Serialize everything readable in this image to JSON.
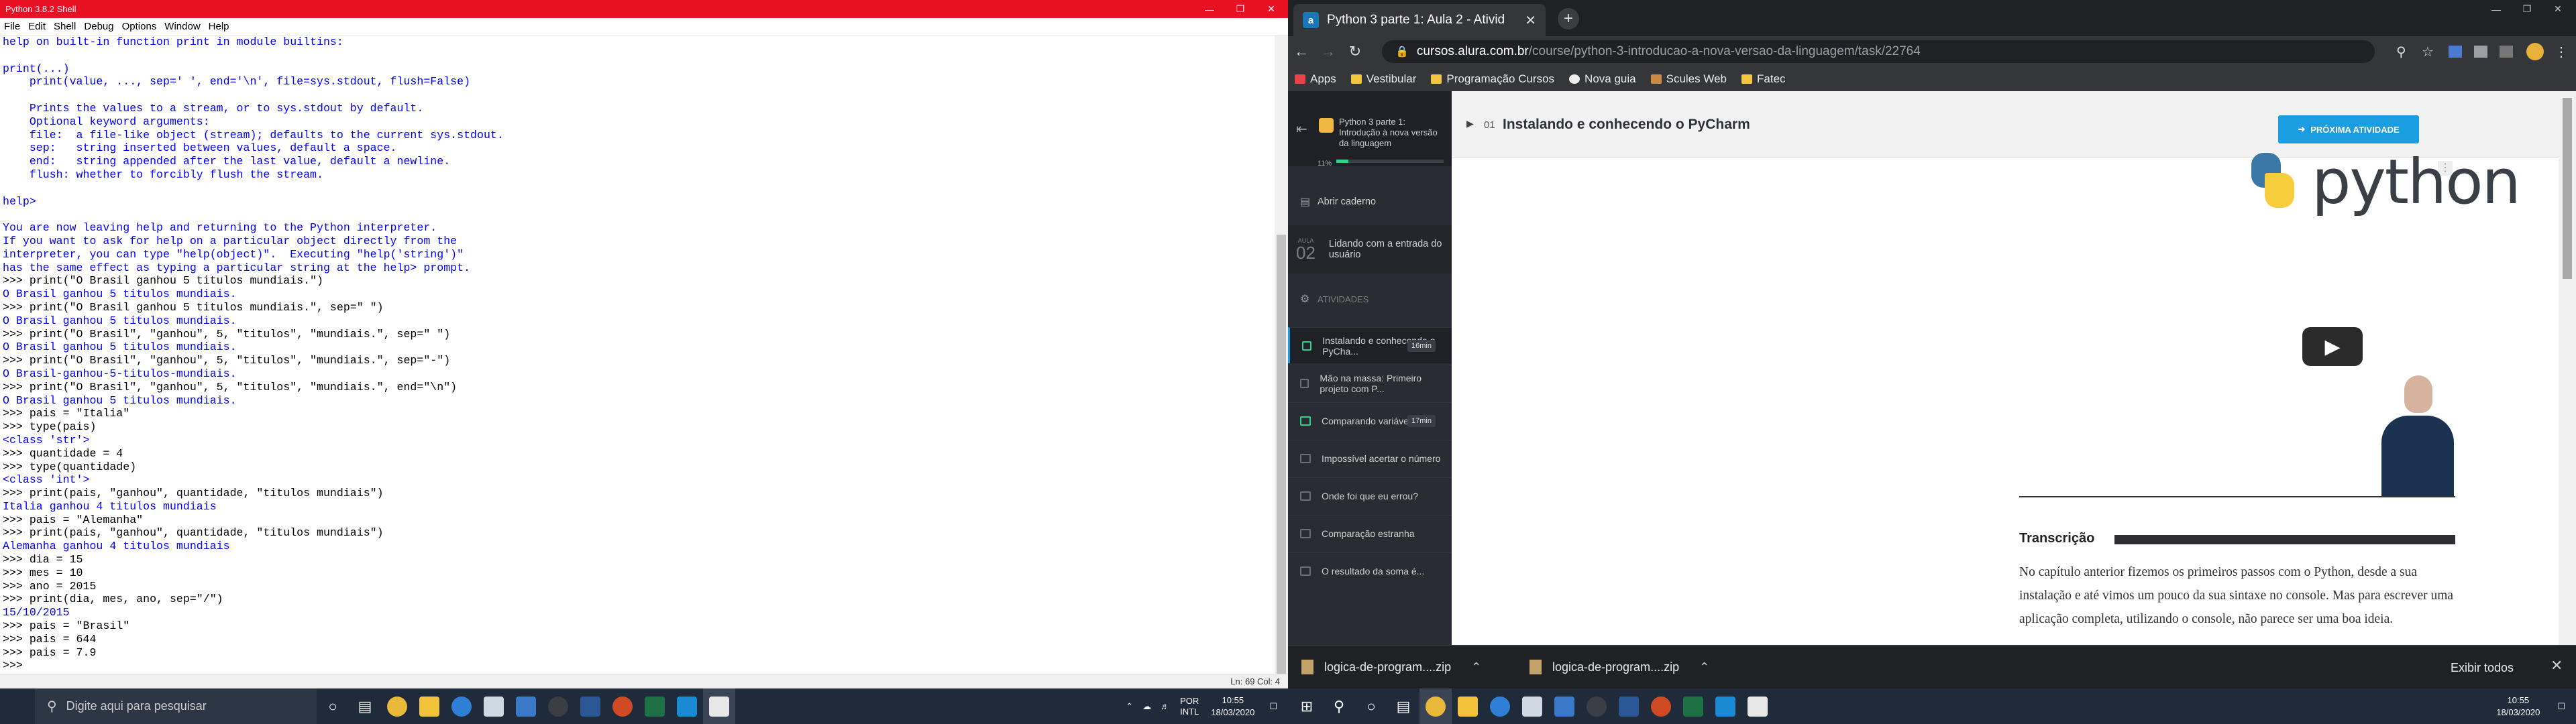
{
  "idle": {
    "window_title": "Python 3.8.2 Shell",
    "menu": [
      "File",
      "Edit",
      "Shell",
      "Debug",
      "Options",
      "Window",
      "Help"
    ],
    "status": "Ln: 69  Col: 4",
    "lines": [
      {
        "t": "help on built-in function print in module builtins:",
        "c": "c-out"
      },
      {
        "t": "",
        "c": "c-out"
      },
      {
        "t": "print(...)",
        "c": "c-out"
      },
      {
        "t": "    print(value, ..., sep=' ', end='\\n', file=sys.stdout, flush=False)",
        "c": "c-out"
      },
      {
        "t": "",
        "c": "c-out"
      },
      {
        "t": "    Prints the values to a stream, or to sys.stdout by default.",
        "c": "c-out"
      },
      {
        "t": "    Optional keyword arguments:",
        "c": "c-out"
      },
      {
        "t": "    file:  a file-like object (stream); defaults to the current sys.stdout.",
        "c": "c-out"
      },
      {
        "t": "    sep:   string inserted between values, default a space.",
        "c": "c-out"
      },
      {
        "t": "    end:   string appended after the last value, default a newline.",
        "c": "c-out"
      },
      {
        "t": "    flush: whether to forcibly flush the stream.",
        "c": "c-out"
      },
      {
        "t": "",
        "c": "c-out"
      },
      {
        "t": "help>",
        "c": "c-out"
      },
      {
        "t": "",
        "c": "c-out"
      },
      {
        "t": "You are now leaving help and returning to the Python interpreter.",
        "c": "c-out"
      },
      {
        "t": "If you want to ask for help on a particular object directly from the",
        "c": "c-out"
      },
      {
        "t": "interpreter, you can type \"help(object)\".  Executing \"help('string')\"",
        "c": "c-out"
      },
      {
        "t": "has the same effect as typing a particular string at the help> prompt.",
        "c": "c-out"
      },
      {
        "t": ">>> print(\"O Brasil ganhou 5 titulos mundiais.\")",
        "c": "c-in"
      },
      {
        "t": "O Brasil ganhou 5 titulos mundiais.",
        "c": "c-out"
      },
      {
        "t": ">>> print(\"O Brasil ganhou 5 titulos mundiais.\", sep=\" \")",
        "c": "c-in"
      },
      {
        "t": "O Brasil ganhou 5 titulos mundiais.",
        "c": "c-out"
      },
      {
        "t": ">>> print(\"O Brasil\", \"ganhou\", 5, \"titulos\", \"mundiais.\", sep=\" \")",
        "c": "c-in"
      },
      {
        "t": "O Brasil ganhou 5 titulos mundiais.",
        "c": "c-out"
      },
      {
        "t": ">>> print(\"O Brasil\", \"ganhou\", 5, \"titulos\", \"mundiais.\", sep=\"-\")",
        "c": "c-in"
      },
      {
        "t": "O Brasil-ganhou-5-titulos-mundiais.",
        "c": "c-out"
      },
      {
        "t": ">>> print(\"O Brasil\", \"ganhou\", 5, \"titulos\", \"mundiais.\", end=\"\\n\")",
        "c": "c-in"
      },
      {
        "t": "O Brasil ganhou 5 titulos mundiais.",
        "c": "c-out"
      },
      {
        "t": ">>> pais = \"Italia\"",
        "c": "c-in"
      },
      {
        "t": ">>> type(pais)",
        "c": "c-in"
      },
      {
        "t": "<class 'str'>",
        "c": "c-out"
      },
      {
        "t": ">>> quantidade = 4",
        "c": "c-in"
      },
      {
        "t": ">>> type(quantidade)",
        "c": "c-in"
      },
      {
        "t": "<class 'int'>",
        "c": "c-out"
      },
      {
        "t": ">>> print(pais, \"ganhou\", quantidade, \"titulos mundiais\")",
        "c": "c-in"
      },
      {
        "t": "Italia ganhou 4 titulos mundiais",
        "c": "c-out"
      },
      {
        "t": ">>> pais = \"Alemanha\"",
        "c": "c-in"
      },
      {
        "t": ">>> print(pais, \"ganhou\", quantidade, \"titulos mundiais\")",
        "c": "c-in"
      },
      {
        "t": "Alemanha ganhou 4 titulos mundiais",
        "c": "c-out"
      },
      {
        "t": ">>> dia = 15",
        "c": "c-in"
      },
      {
        "t": ">>> mes = 10",
        "c": "c-in"
      },
      {
        "t": ">>> ano = 2015",
        "c": "c-in"
      },
      {
        "t": ">>> print(dia, mes, ano, sep=\"/\")",
        "c": "c-in"
      },
      {
        "t": "15/10/2015",
        "c": "c-out"
      },
      {
        "t": ">>> pais = \"Brasil\"",
        "c": "c-in"
      },
      {
        "t": ">>> pais = 644",
        "c": "c-in"
      },
      {
        "t": ">>> pais = 7.9",
        "c": "c-in"
      },
      {
        "t": ">>> ",
        "c": "c-in"
      }
    ]
  },
  "taskbar_left": {
    "search_placeholder": "Digite aqui para pesquisar",
    "lang": "POR",
    "lang2": "INTL",
    "time": "10:55",
    "date": "18/03/2020"
  },
  "chrome": {
    "tab_title": "Python 3 parte 1: Aula 2 - Ativid",
    "tab_fav": "a",
    "url_host": "cursos.alura.com.br",
    "url_path": "/course/python-3-introducao-a-nova-versao-da-linguagem/task/22764",
    "bookmarks": [
      "Apps",
      "Vestibular",
      "Programação Cursos",
      "Nova guia",
      "Scules Web",
      "Fatec"
    ]
  },
  "alura": {
    "course_title": "Python 3 parte 1: Introdução à nova versão da linguagem",
    "progress_pct": 11,
    "progress_label": "11%",
    "notebook": "Abrir caderno",
    "aula_label": "AULA",
    "aula_num": "02",
    "aula_title": "Lidando com a entrada do usuário",
    "activities_header": "ATIVIDADES",
    "activities": [
      {
        "title": "Instalando e conhecendo o PyCha...",
        "dur": "16min",
        "state": "cur"
      },
      {
        "title": "Mão na massa: Primeiro projeto com P...",
        "dur": "",
        "state": "todo"
      },
      {
        "title": "Comparando variáveis",
        "dur": "17min",
        "state": "done"
      },
      {
        "title": "Impossível acertar o número",
        "dur": "",
        "state": "todo"
      },
      {
        "title": "Onde foi que eu errou?",
        "dur": "",
        "state": "todo"
      },
      {
        "title": "Comparação estranha",
        "dur": "",
        "state": "todo"
      },
      {
        "title": "O resultado da soma é...",
        "dur": "",
        "state": "todo"
      }
    ],
    "lesson_num": "01",
    "lesson_title": "Instalando e conhecendo o PyCharm",
    "next_label": "PRÓXIMA ATIVIDADE",
    "video_word": "python",
    "transcript_label": "Transcrição",
    "transcript_text": "No capítulo anterior fizemos os primeiros passos com o Python, desde a sua instalação e até vimos um pouco da sua sintaxe no console. Mas para escrever uma aplicação completa, utilizando o console, não parece ser uma boa ideia."
  },
  "downloads": {
    "items": [
      "logica-de-program....zip",
      "logica-de-program....zip"
    ],
    "show_all": "Exibir todos"
  },
  "taskbar_right": {
    "time": "10:55",
    "date": "18/03/2020"
  }
}
